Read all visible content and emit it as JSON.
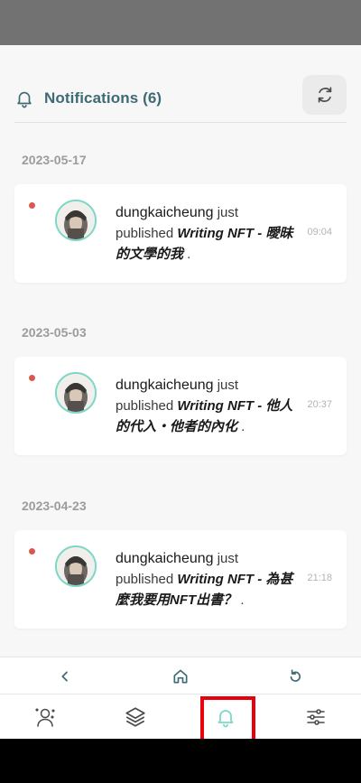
{
  "header": {
    "title": "Notifications (6)",
    "bell_icon": "bell-icon",
    "refresh_icon": "refresh-icon"
  },
  "colors": {
    "accent": "#3e6a75",
    "teal": "#7dd7c7",
    "unread_dot": "#d9584f",
    "highlight": "#e8000d"
  },
  "notifications": [
    {
      "date": "2023-05-17",
      "user": "dungkaicheung",
      "pre": " just published ",
      "title": "Writing NFT - 曖昧的文學的我",
      "post": " .",
      "time": "09:04",
      "unread": true
    },
    {
      "date": "2023-05-03",
      "user": "dungkaicheung",
      "pre": " just published ",
      "title": "Writing NFT - 他人的代入・他者的內化",
      "post": " .",
      "time": "20:37",
      "unread": true
    },
    {
      "date": "2023-04-23",
      "user": "dungkaicheung",
      "pre": " just published ",
      "title": "Writing NFT - 為甚麼我要用NFT出書？",
      "post": " .",
      "time": "21:18",
      "unread": true
    }
  ],
  "browser_nav": {
    "back_icon": "chevron-left-icon",
    "home_icon": "home-icon",
    "reload_icon": "reload-icon"
  },
  "tabs": [
    {
      "name": "profile",
      "icon": "person-icon",
      "active": false
    },
    {
      "name": "portfolio",
      "icon": "layers-icon",
      "active": false
    },
    {
      "name": "notifications",
      "icon": "bell-icon",
      "active": true
    },
    {
      "name": "settings",
      "icon": "sliders-icon",
      "active": false
    }
  ]
}
